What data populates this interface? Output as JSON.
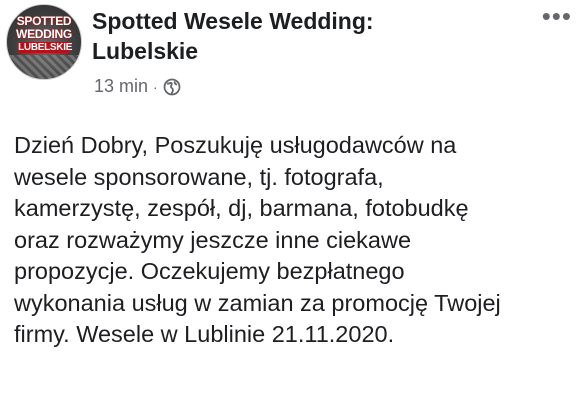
{
  "post": {
    "avatar": {
      "line1": "SPOTTED",
      "line2": "WEDDING",
      "line3": "LUBELSKIE"
    },
    "page_name_line1": "Spotted Wesele Wedding:",
    "page_name_line2": "Lubelskie",
    "timestamp": "13 min",
    "separator": "·",
    "privacy_icon": "globe-icon",
    "more_icon": "more-options-icon",
    "more_glyph": "•••",
    "body_lines": [
      "Dzień Dobry, Poszukuję usługodawców na",
      "wesele sponsorowane, tj. fotografa,",
      "kamerzystę, zespół, dj, barmana, fotobudkę",
      "oraz rozważymy jeszcze inne ciekawe",
      "propozycje. Oczekujemy bezpłatnego",
      "wykonania usług w zamian za promocję Twojej",
      "firmy. Wesele w Lublinie 21.11.2020."
    ]
  },
  "colors": {
    "text": "#1c1e21",
    "secondary_text": "#65676b",
    "background": "#ffffff"
  }
}
